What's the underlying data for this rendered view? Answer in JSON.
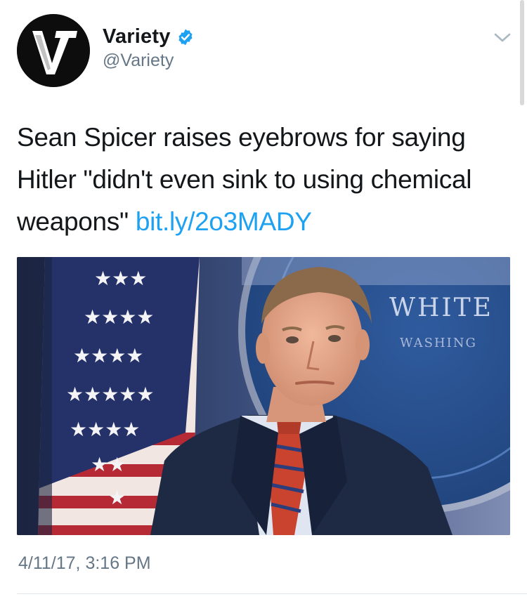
{
  "account": {
    "display_name": "Variety",
    "handle": "@Variety",
    "avatar_icon": "variety-v-logo-icon",
    "verified_icon": "verified-badge-icon",
    "verified_color": "#1da1f2"
  },
  "menu": {
    "caret_icon": "chevron-down-icon"
  },
  "tweet": {
    "text": "Sean Spicer raises eyebrows for saying Hitler \"didn't even sink to using chemical weapons\"",
    "link": "bit.ly/2o3MADY",
    "link_color": "#1da1f2",
    "timestamp": "4/11/17, 3:16 PM"
  },
  "media": {
    "seal_text_top": "WHITE",
    "seal_text_bottom": "WASHING"
  }
}
